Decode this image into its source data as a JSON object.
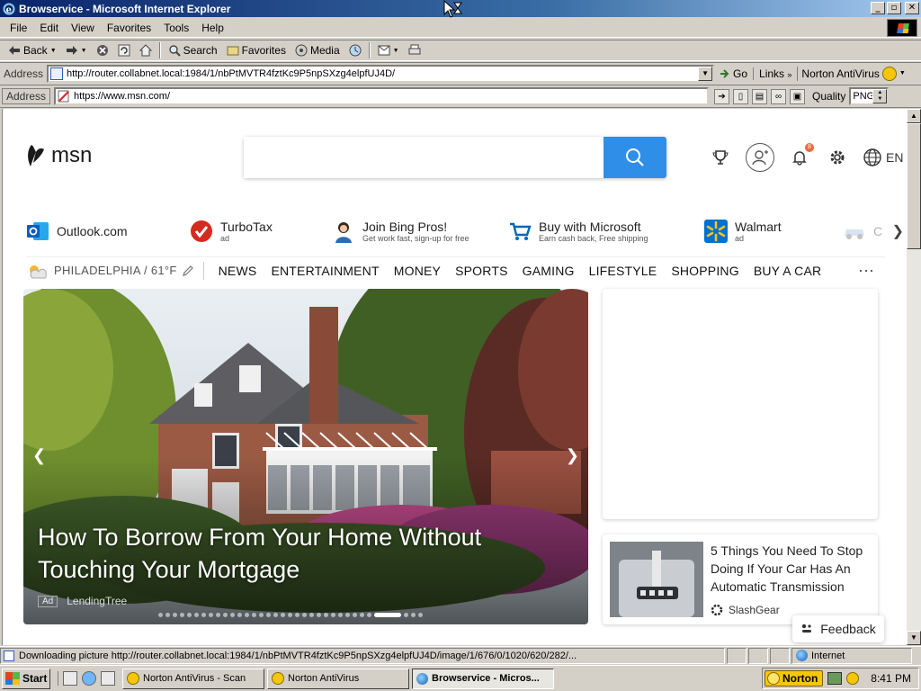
{
  "window": {
    "title": "Browservice - Microsoft Internet Explorer",
    "buttons": {
      "minimize": "_",
      "maximize": "▫",
      "close": "✕"
    }
  },
  "menu": [
    "File",
    "Edit",
    "View",
    "Favorites",
    "Tools",
    "Help"
  ],
  "toolbar": {
    "back": "Back",
    "search": "Search",
    "favorites": "Favorites",
    "media": "Media"
  },
  "address": {
    "label": "Address",
    "url": "http://router.collabnet.local:1984/1/nbPtMVTR4fztKc9P5npSXzg4elpfUJ4D/",
    "go": "Go",
    "links": "Links",
    "norton": "Norton AntiVirus"
  },
  "browservice": {
    "label": "Address",
    "url": "https://www.msn.com/",
    "quality_label": "Quality",
    "quality_value": "PNG"
  },
  "msn": {
    "logo_text": "msn",
    "search_placeholder": "",
    "notification_count": "8",
    "language": "EN",
    "quicklinks": [
      {
        "title": "Outlook.com",
        "sub": ""
      },
      {
        "title": "TurboTax",
        "sub": "ad"
      },
      {
        "title": "Join Bing Pros!",
        "sub": "Get work fast, sign-up for free"
      },
      {
        "title": "Buy with Microsoft",
        "sub": "Earn cash back, Free shipping"
      },
      {
        "title": "Walmart",
        "sub": "ad"
      },
      {
        "title": "C",
        "sub": ""
      }
    ],
    "weather": "PHILADELPHIA / 61°F",
    "nav": [
      "NEWS",
      "ENTERTAINMENT",
      "MONEY",
      "SPORTS",
      "GAMING",
      "LIFESTYLE",
      "SHOPPING",
      "BUY A CAR"
    ],
    "more": "···",
    "hero": {
      "title": "How To Borrow From Your Home Without Touching Your Mortgage",
      "ad_tag": "Ad",
      "source": "LendingTree",
      "slide_count": 34,
      "active_slide": 31
    },
    "card": {
      "title": "5 Things You Need To Stop Doing If Your Car Has An Automatic Transmission",
      "source": "SlashGear"
    },
    "feedback": "Feedback"
  },
  "status": {
    "text": "Downloading picture http://router.collabnet.local:1984/1/nbPtMVTR4fztKc9P5npSXzg4elpfUJ4D/image/1/676/0/1020/620/282/...",
    "zone": "Internet"
  },
  "taskbar": {
    "start": "Start",
    "tasks": [
      "Norton AntiVirus - Scan",
      "Norton AntiVirus",
      "Browservice - Micros..."
    ],
    "norton": "Norton",
    "clock": "8:41 PM"
  },
  "colors": {
    "accent": "#2f8ee8",
    "titlebar": "#0a246a",
    "chrome": "#d4d0c8"
  }
}
